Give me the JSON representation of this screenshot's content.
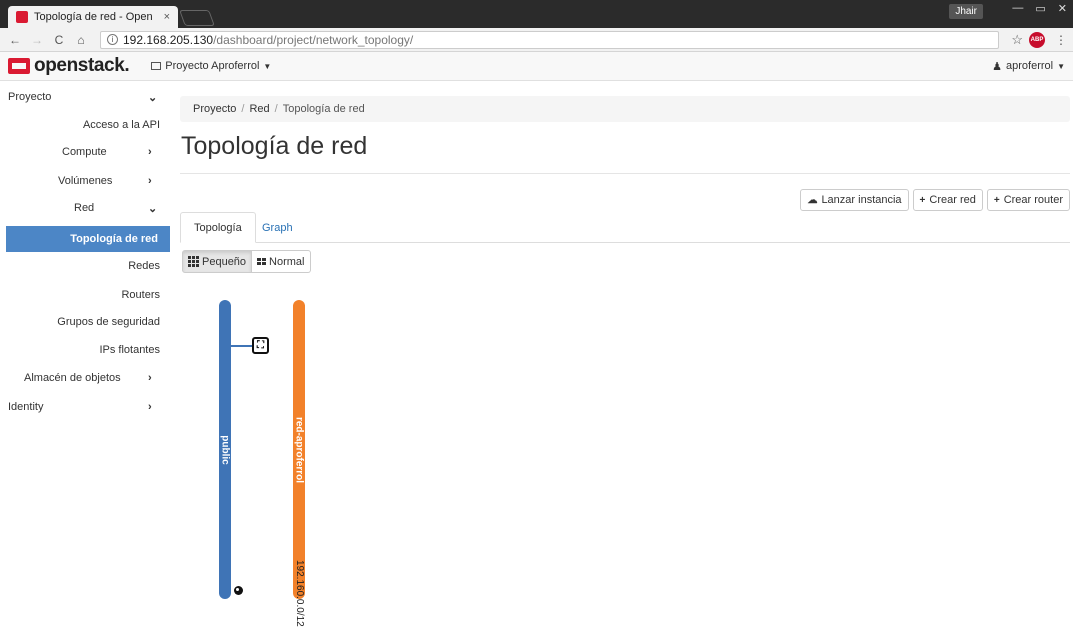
{
  "browser": {
    "tab_title": "Topología de red - Open",
    "tab_close": "×",
    "window_user": "Jhair",
    "window_controls": [
      "—",
      "▭",
      "✕"
    ],
    "nav": {
      "back": "←",
      "forward": "→",
      "reload": "C",
      "home": "⌂"
    },
    "url_host": "192.168.205.130",
    "url_path": "/dashboard/project/network_topology/",
    "star": "☆",
    "abp": "ABP",
    "menu": "⋮"
  },
  "header": {
    "logo_text": "openstack.",
    "project_label": "Proyecto Aproferrol",
    "user_label": "aproferrol"
  },
  "sidebar": {
    "items": [
      {
        "label": "Proyecto",
        "chevron": "⌄"
      },
      {
        "label": "Acceso a la API"
      },
      {
        "label": "Compute",
        "chevron": "›"
      },
      {
        "label": "Volúmenes",
        "chevron": "›"
      },
      {
        "label": "Red",
        "chevron": "⌄"
      },
      {
        "label": "Topología de red"
      },
      {
        "label": "Redes"
      },
      {
        "label": "Routers"
      },
      {
        "label": "Grupos de seguridad"
      },
      {
        "label": "IPs flotantes"
      },
      {
        "label": "Almacén de objetos",
        "chevron": "›"
      },
      {
        "label": "Identity",
        "chevron": "›"
      }
    ]
  },
  "breadcrumb": {
    "items": [
      "Proyecto",
      "Red",
      "Topología de red"
    ],
    "sep": "/"
  },
  "page_title": "Topología de red",
  "actions": {
    "launch": "Lanzar instancia",
    "create_network": "Crear red",
    "create_router": "Crear router"
  },
  "tabs": [
    "Topología",
    "Graph"
  ],
  "size_buttons": [
    "Pequeño",
    "Normal"
  ],
  "topology": {
    "networks": [
      {
        "name": "public",
        "color": "#3f74b6"
      },
      {
        "name": "red-aproferrol",
        "color": "#f2812a",
        "cidr": "192.160.0.0/12"
      }
    ],
    "router_glyph": "⛶"
  }
}
